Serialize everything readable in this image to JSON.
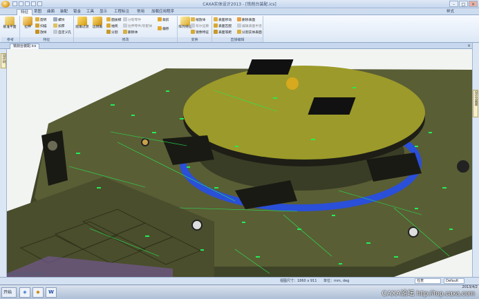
{
  "window": {
    "title": "CAXA实体设计2013 - [铣削台装配.ics]",
    "minimize": "–",
    "maximize": "□",
    "close": "×"
  },
  "tabs": [
    "特征",
    "草图",
    "曲面",
    "装配",
    "钣金",
    "工具",
    "显示",
    "工程标注",
    "常用",
    "加载应用程序"
  ],
  "active_tab": 0,
  "style_menu": "样式",
  "ribbon": {
    "groups": [
      {
        "label": "参考",
        "buttons": [
          "基准平面",
          "拉伸"
        ]
      },
      {
        "label": "特征",
        "buttons": [
          "旋转",
          "扫描",
          "放样",
          "螺纹",
          "加厚",
          "自定义孔"
        ]
      },
      {
        "label": "修改",
        "buttons": [
          "圆角过渡",
          "边倒角",
          "面拔模",
          "抽壳",
          "分割",
          "分裂零件",
          "拉伸零件/装配体",
          "删除体",
          "裁剪",
          "偏移"
        ]
      },
      {
        "label": "变换",
        "buttons": [
          "阵列特征",
          "缩放体",
          "镜像特征",
          "布尔运算"
        ]
      },
      {
        "label": "直接编辑",
        "buttons": [
          "表面移动",
          "表面匹配",
          "表面等距",
          "删除表面",
          "编辑表面半径",
          "分割实体表面"
        ]
      }
    ]
  },
  "document": {
    "tab_label": "铣削台装配.ics",
    "close": "×"
  },
  "side_panels": {
    "left": "设计树",
    "right": "设计元素库"
  },
  "viewport": {
    "footer_url": "http://www.caxa.com"
  },
  "status": {
    "view_size": "视图尺寸：1860 x 911",
    "units": "单位：mm, deg",
    "filter": "任意",
    "scheme": "Default"
  },
  "taskbar": {
    "start": "开始",
    "apps": [
      "CAXA",
      "Word"
    ],
    "watermark": "CAXA论坛  http://top.caxa.com",
    "date": "2013/4/2"
  },
  "colors": {
    "plate_dark": "#3f4428",
    "plate_top": "#5a5e35",
    "turntable": "#9c9a2a",
    "annotation": "#22ee55",
    "ring": "#2a4fd8"
  }
}
